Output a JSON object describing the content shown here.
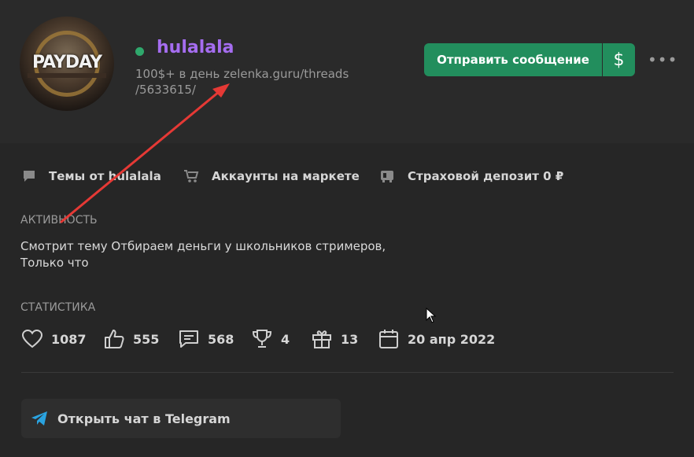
{
  "profile": {
    "username": "hulalala",
    "status_line1": "100$+ в день zelenka.guru/threads",
    "status_line2": "/5633615/",
    "avatar_text": "PAYDAY",
    "online": true
  },
  "actions": {
    "send_message": "Отправить сообщение",
    "money_symbol": "$",
    "more": "•••"
  },
  "links": [
    {
      "label": "Темы от hulalala",
      "icon": "chat-bubble-icon"
    },
    {
      "label": "Аккаунты на маркете",
      "icon": "cart-icon"
    },
    {
      "label": "Страховой депозит 0 ₽",
      "icon": "deposit-icon"
    }
  ],
  "activity": {
    "title": "АКТИВНОСТЬ",
    "line1": "Смотрит тему Отбираем деньги у школьников стримеров,",
    "line2": "Только что"
  },
  "stats": {
    "title": "СТАТИСТИКА",
    "items": [
      {
        "icon": "heart-icon",
        "value": "1087"
      },
      {
        "icon": "thumbs-up-icon",
        "value": "555"
      },
      {
        "icon": "message-icon",
        "value": "568"
      },
      {
        "icon": "trophy-icon",
        "value": "4"
      },
      {
        "icon": "gift-icon",
        "value": "13"
      },
      {
        "icon": "calendar-icon",
        "value": "20 апр 2022"
      }
    ]
  },
  "telegram": {
    "label": "Открыть чат в Telegram",
    "icon": "telegram-icon"
  },
  "colors": {
    "accent_green": "#228e5d",
    "username_purple": "#a56df0",
    "online_green": "#2fa86c",
    "annotation_red": "#e53935"
  }
}
